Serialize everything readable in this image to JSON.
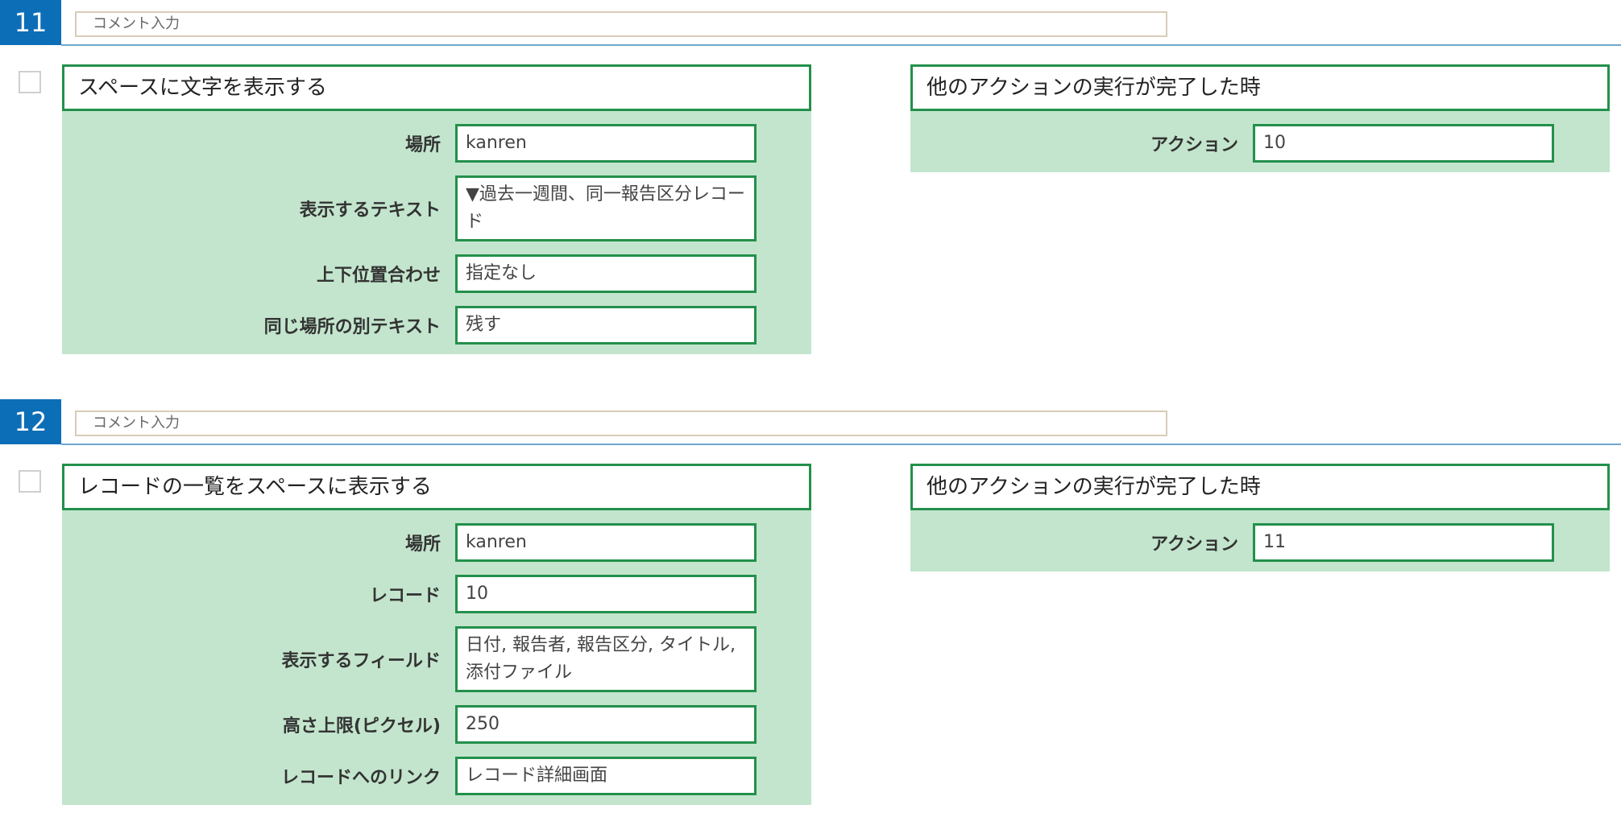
{
  "steps": [
    {
      "number": "11",
      "comment_placeholder": "コメント入力",
      "action": {
        "title": "スペースに文字を表示する",
        "fields": [
          {
            "label": "場所",
            "value": "kanren"
          },
          {
            "label": "表示するテキスト",
            "value": "▼過去一週間、同一報告区分レコード"
          },
          {
            "label": "上下位置合わせ",
            "value": "指定なし"
          },
          {
            "label": "同じ場所の別テキスト",
            "value": "残す"
          }
        ]
      },
      "trigger": {
        "title": "他のアクションの実行が完了した時",
        "fields": [
          {
            "label": "アクション",
            "value": "10"
          }
        ]
      }
    },
    {
      "number": "12",
      "comment_placeholder": "コメント入力",
      "action": {
        "title": "レコードの一覧をスペースに表示する",
        "fields": [
          {
            "label": "場所",
            "value": "kanren"
          },
          {
            "label": "レコード",
            "value": "10"
          },
          {
            "label": "表示するフィールド",
            "value": "日付, 報告者, 報告区分, タイトル, 添付ファイル"
          },
          {
            "label": "高さ上限(ピクセル)",
            "value": "250"
          },
          {
            "label": "レコードへのリンク",
            "value": "レコード詳細画面"
          }
        ]
      },
      "trigger": {
        "title": "他のアクションの実行が完了した時",
        "fields": [
          {
            "label": "アクション",
            "value": "11"
          }
        ]
      }
    }
  ],
  "colors": {
    "step_badge": "#0d6eb8",
    "panel_border": "#23904b",
    "panel_body": "#c3e5cd"
  }
}
